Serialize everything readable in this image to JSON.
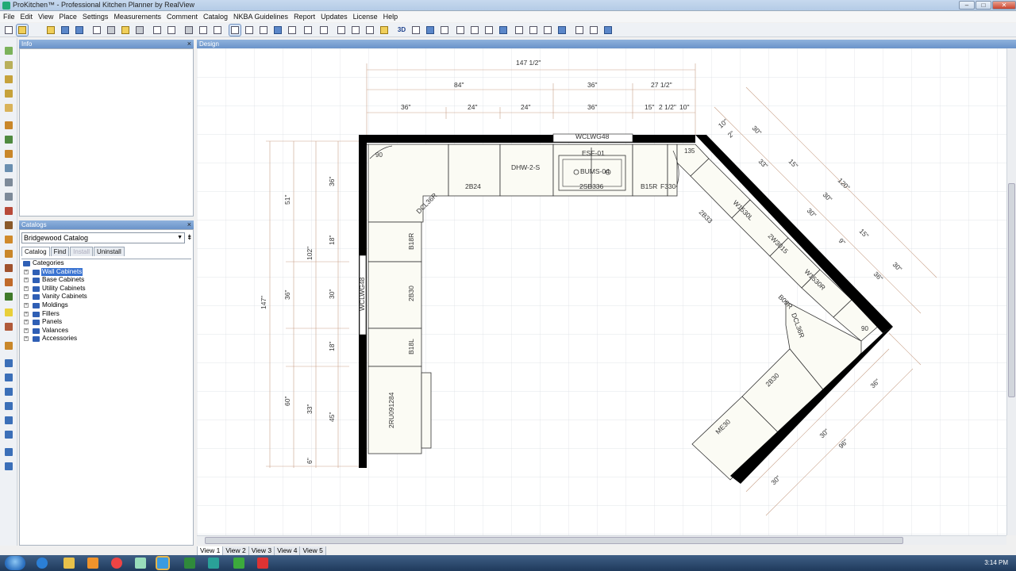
{
  "window": {
    "title": "ProKitchen™ - Professional Kitchen Planner by RealView",
    "controls": [
      "–",
      "□",
      "✕"
    ]
  },
  "menu": [
    "File",
    "Edit",
    "View",
    "Place",
    "Settings",
    "Measurements",
    "Comment",
    "Catalog",
    "NKBA Guidelines",
    "Report",
    "Updates",
    "License",
    "Help"
  ],
  "panels": {
    "info_title": "Info",
    "catalog_title": "Catalogs",
    "design_title": "Design",
    "close_glyph": "×"
  },
  "catalog": {
    "selected": "Bridgewood Catalog",
    "tabs": [
      "Catalog",
      "Find",
      "Install",
      "Uninstall"
    ],
    "root": "Categories",
    "categories": [
      "Wall Cabinets",
      "Base Cabinets",
      "Utility Cabinets",
      "Vanity Cabinets",
      "Moldings",
      "Fillers",
      "Panels",
      "Valances",
      "Accessories"
    ]
  },
  "view_tabs": [
    "View 1",
    "View 2",
    "View 3",
    "View 4",
    "View 5"
  ],
  "toolbar": {
    "view3d_label": "3D"
  },
  "taskbar": {
    "clock": "3:14 PM"
  },
  "plan": {
    "dims_top": [
      "147 1/2\"",
      "84\"",
      "36\"",
      "27 1/2\"",
      "36\"",
      "24\"",
      "24\"",
      "36\"",
      "15\"",
      "2 1/2\"",
      "10\""
    ],
    "dims_left": [
      "51\"",
      "102\"",
      "147\"",
      "60\"",
      "36\"",
      "36\"",
      "33\"",
      "6\"",
      "18\"",
      "30\"",
      "18\"",
      "45\""
    ],
    "dims_right": [
      "10\"",
      "2\"",
      "30\"",
      "33\"",
      "15\"",
      "120\"",
      "30\"",
      "30\"",
      "9\"",
      "15\"",
      "36\"",
      "30\"",
      "36\"",
      "30\"",
      "96\"",
      "30\""
    ],
    "cabinets": [
      "WCLWG48",
      "ESF-01",
      "BUMS-04",
      "2SB336",
      "DHW-2-S",
      "2B24",
      "B15R",
      "F330",
      "DCL36R",
      "B18R",
      "2B30",
      "B18L",
      "2RU091284",
      "WCLWG48",
      "2B33",
      "W1530L",
      "2W3015",
      "W1530R",
      "B09R",
      "DCL36R",
      "2B30",
      "ME30"
    ],
    "angles": [
      "90",
      "135",
      "90"
    ]
  }
}
